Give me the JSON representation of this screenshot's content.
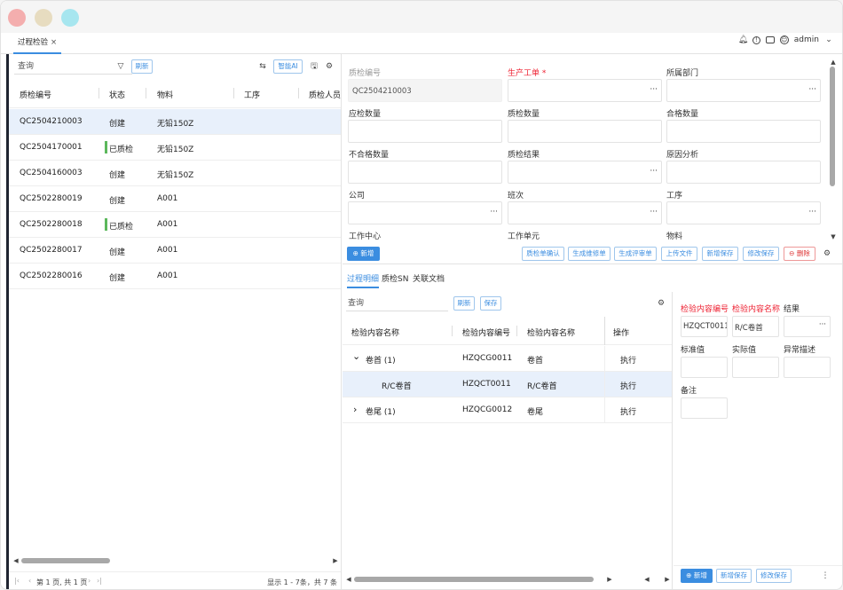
{
  "header": {
    "tab_label": "过程检验",
    "tab_close": "×",
    "user": "admin"
  },
  "left": {
    "search_placeholder": "查询",
    "refresh": "刷新",
    "ai": "智能AI",
    "columns": [
      "质检编号",
      "状态",
      "物料",
      "工序",
      "质检人员"
    ],
    "rows": [
      {
        "code": "QC2504210003",
        "status": "创建",
        "material": "无铅150Z",
        "checked": false
      },
      {
        "code": "QC2504170001",
        "status": "已质检",
        "material": "无铅150Z",
        "checked": true
      },
      {
        "code": "QC2504160003",
        "status": "创建",
        "material": "无铅150Z",
        "checked": false
      },
      {
        "code": "QC2502280019",
        "status": "创建",
        "material": "A001",
        "checked": false
      },
      {
        "code": "QC2502280018",
        "status": "已质检",
        "material": "A001",
        "checked": true
      },
      {
        "code": "QC2502280017",
        "status": "创建",
        "material": "A001",
        "checked": false
      },
      {
        "code": "QC2502280016",
        "status": "创建",
        "material": "A001",
        "checked": false
      }
    ],
    "pager": "第 1 页, 共 1 页",
    "summary": "显示 1 - 7条，共 7 条"
  },
  "form": {
    "labels": {
      "qc_code": "质检编号",
      "work_order": "生产工单",
      "work_order_req": "*",
      "dept": "所属部门",
      "qty": "应检数量",
      "qc_qty": "质检数量",
      "ok_qty": "合格数量",
      "ng_qty": "不合格数量",
      "result": "质检结果",
      "cause": "原因分析",
      "company": "公司",
      "shift": "班次",
      "process": "工序",
      "work_center": "工作中心",
      "work_unit": "工作单元",
      "material": "物料"
    },
    "qc_code_value": "QC2504210003"
  },
  "actions": {
    "add": "新增",
    "confirm": "质检单确认",
    "repair": "生成维修单",
    "review": "生成评审单",
    "upload": "上传文件",
    "save_new": "新增保存",
    "save_edit": "修改保存",
    "delete": "删除"
  },
  "detail": {
    "tabs": [
      "过程明细",
      "质检SN",
      "关联文档"
    ],
    "search_placeholder": "查询",
    "refresh": "刷新",
    "save": "保存",
    "columns": [
      "检验内容名称",
      "检验内容编号",
      "检验内容名称",
      "操作"
    ],
    "rows": [
      {
        "name": "卷首 (1)",
        "code": "HZQCG0011",
        "cname": "卷首",
        "op": "执行",
        "expander": "⌄"
      },
      {
        "name": "R/C卷首",
        "code": "HZQCT0011",
        "cname": "R/C卷首",
        "op": "执行",
        "expander": ""
      },
      {
        "name": "卷尾 (1)",
        "code": "HZQCG0012",
        "cname": "卷尾",
        "op": "执行",
        "expander": "›"
      }
    ]
  },
  "side": {
    "labels": {
      "code": "检验内容编号",
      "name": "检验内容名称",
      "result": "结果",
      "std": "标准值",
      "actual": "实际值",
      "abn": "异常描述",
      "note": "备注"
    },
    "code_value": "HZQCT0011",
    "name_value": "R/C卷首",
    "add": "新增",
    "save_new": "新增保存",
    "save_edit": "修改保存"
  }
}
